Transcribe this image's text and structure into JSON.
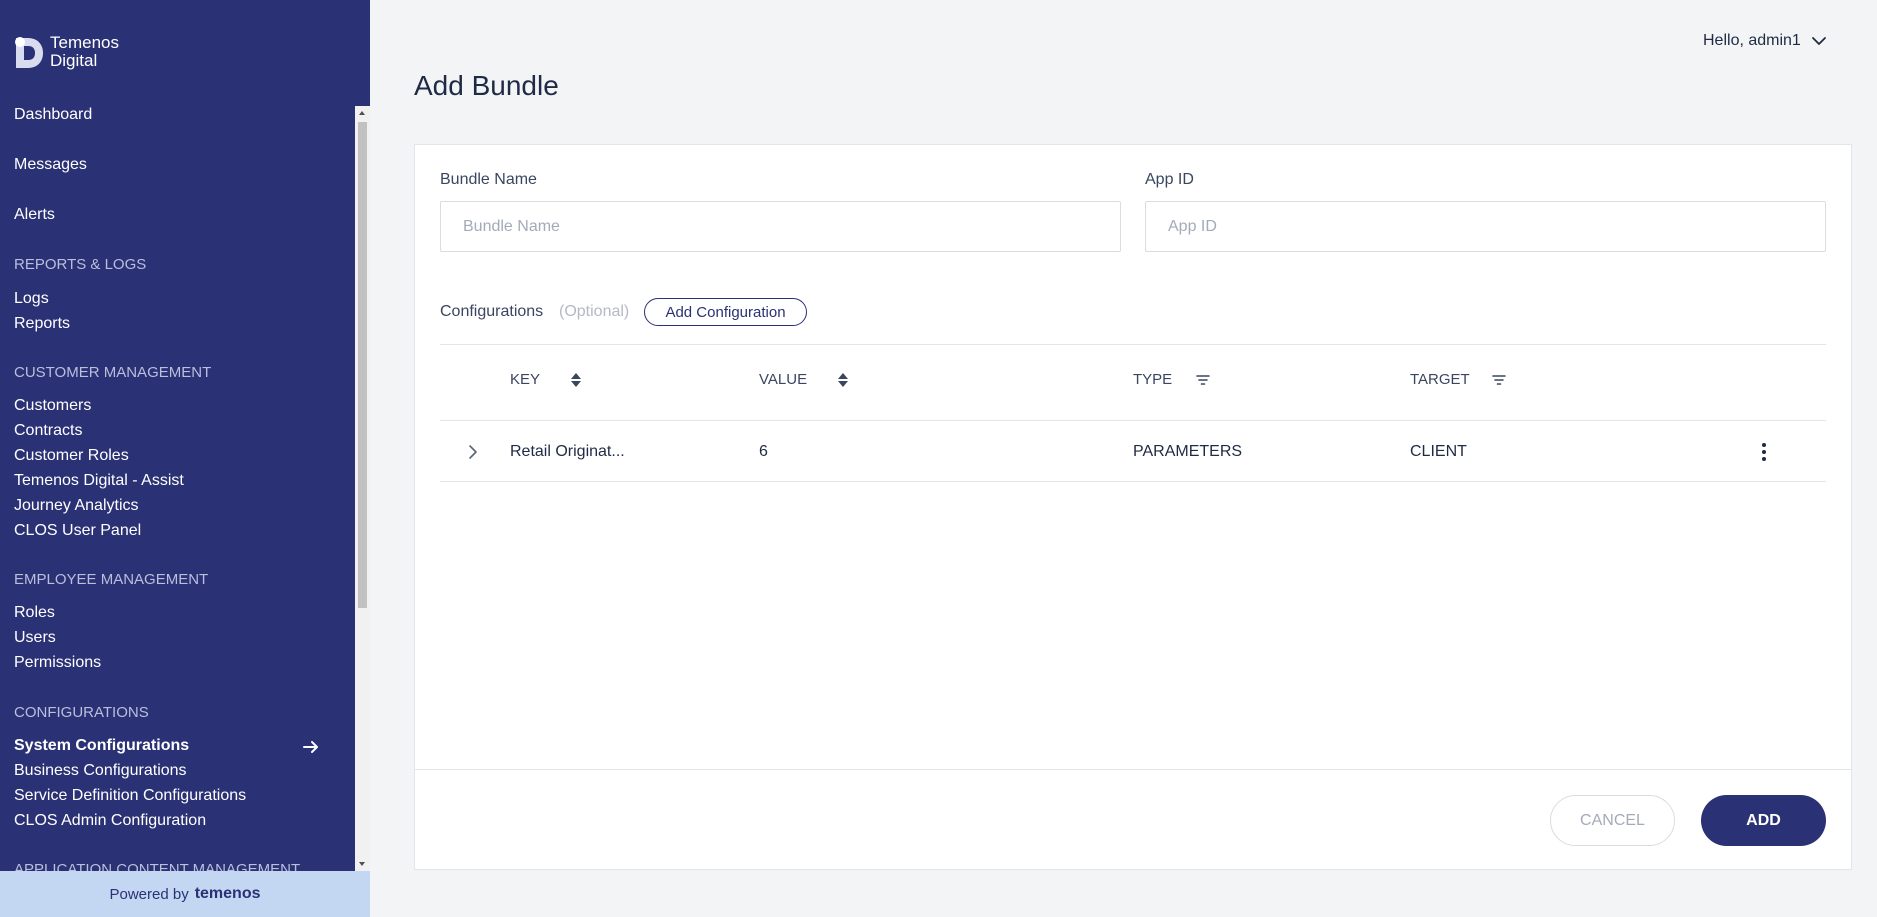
{
  "brand": {
    "line1": "Temenos",
    "line2": "Digital",
    "powered_by": "Powered by",
    "powered_brand": "temenos"
  },
  "sidebar": {
    "top_items": [
      "Dashboard",
      "Messages",
      "Alerts"
    ],
    "sections": [
      {
        "heading": "REPORTS & LOGS",
        "items": [
          "Logs",
          "Reports"
        ]
      },
      {
        "heading": "CUSTOMER MANAGEMENT",
        "items": [
          "Customers",
          "Contracts",
          "Customer Roles",
          "Temenos Digital - Assist",
          "Journey Analytics",
          "CLOS User Panel"
        ]
      },
      {
        "heading": "EMPLOYEE MANAGEMENT",
        "items": [
          "Roles",
          "Users",
          "Permissions"
        ]
      },
      {
        "heading": "CONFIGURATIONS",
        "items": [
          "System Configurations",
          "Business Configurations",
          "Service Definition Configurations",
          "CLOS Admin Configuration"
        ]
      },
      {
        "heading": "APPLICATION CONTENT MANAGEMENT",
        "items": []
      }
    ],
    "active_item": "System Configurations"
  },
  "header": {
    "greeting": "Hello, admin1"
  },
  "page": {
    "title": "Add Bundle"
  },
  "form": {
    "bundle_name": {
      "label": "Bundle Name",
      "placeholder": "Bundle Name",
      "value": ""
    },
    "app_id": {
      "label": "App ID",
      "placeholder": "App ID",
      "value": ""
    }
  },
  "configurations": {
    "label": "Configurations",
    "optional": "(Optional)",
    "add_button": "Add Configuration",
    "columns": [
      "KEY",
      "VALUE",
      "TYPE",
      "TARGET"
    ],
    "rows": [
      {
        "key": "Retail Originat...",
        "value": "6",
        "type": "PARAMETERS",
        "target": "CLIENT"
      }
    ]
  },
  "footer": {
    "cancel": "CANCEL",
    "add": "ADD"
  },
  "colors": {
    "sidebar": "#2a3174",
    "accent": "#2a3174",
    "powered_bg": "#c4d7f2"
  }
}
